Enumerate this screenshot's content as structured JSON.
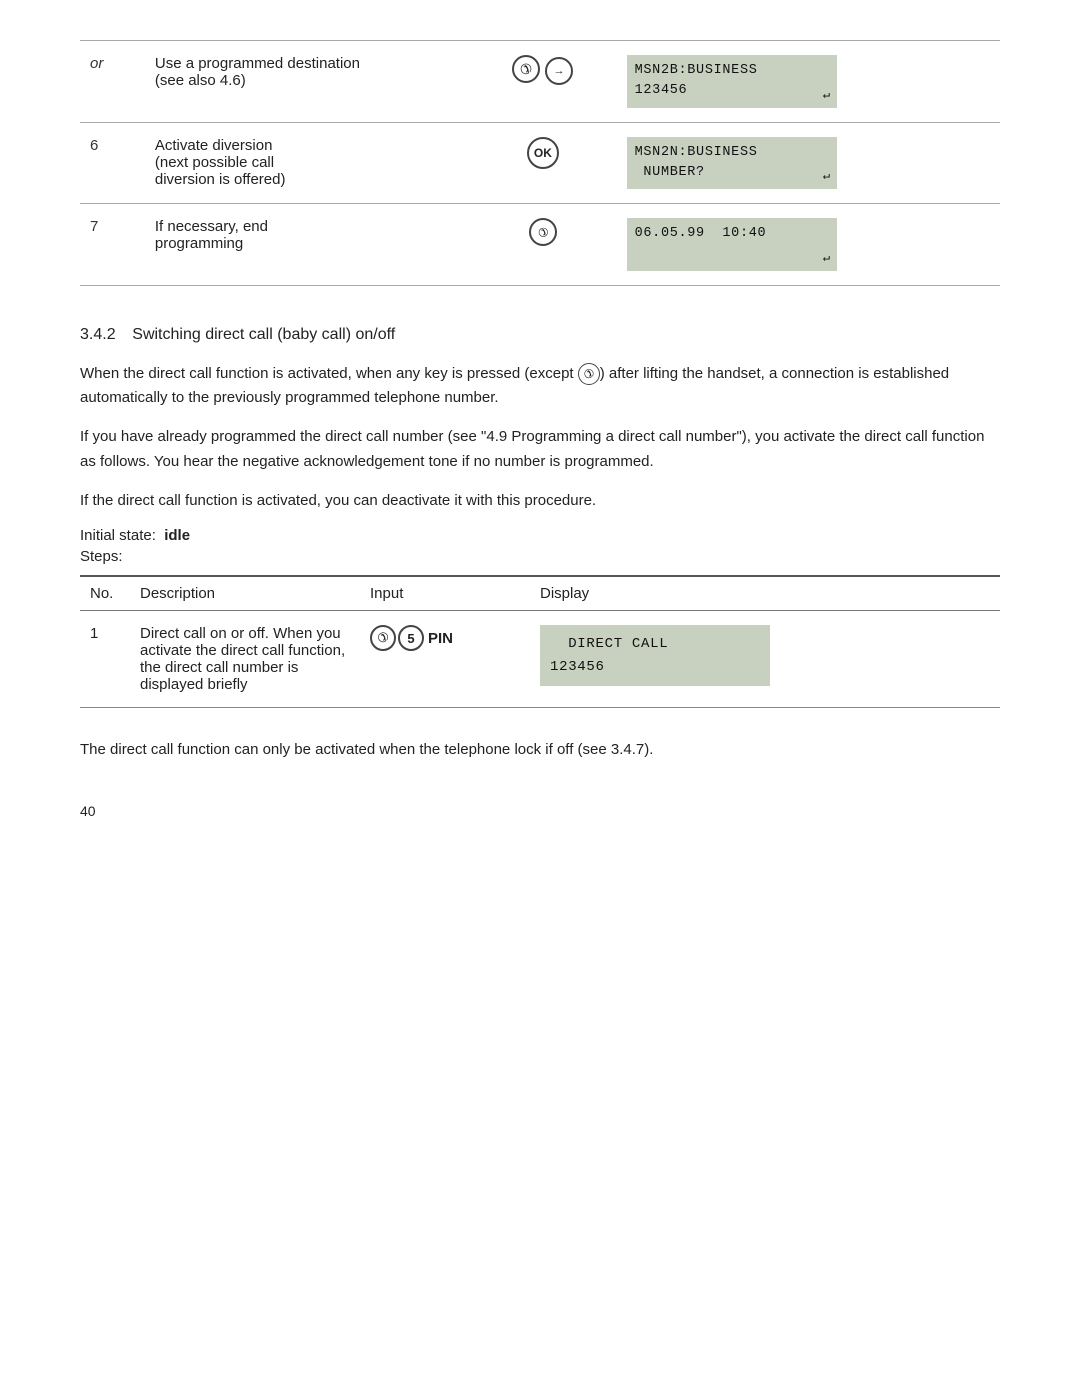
{
  "top_table": {
    "rows": [
      {
        "num": "or",
        "num_italic": true,
        "desc": "Use a programmed destination\n(see also 4.6)",
        "input_type": "two_circles",
        "display_lines": [
          "MSN2B:BUSINESS",
          "123456 "
        ],
        "show_back_arrow": true
      },
      {
        "num": "6",
        "desc": "Activate diversion\n(next possible call\ndiversion is offered)",
        "input_type": "ok",
        "display_lines": [
          "MSN2N:BUSINESS",
          " NUMBER?"
        ],
        "show_back_arrow": true
      },
      {
        "num": "7",
        "desc": "If necessary, end\nprogramming",
        "input_type": "end_call",
        "display_lines": [
          "06.05.99  10:40",
          ""
        ],
        "show_back_arrow": true
      }
    ]
  },
  "section": {
    "number": "3.4.2",
    "title": "Switching direct call (baby call) on/off"
  },
  "body_paragraphs": [
    "When the direct call function is activated, when any key is pressed (except ①) after lifting the handset, a connection is established automatically to the previously programmed telephone number.",
    "If you have already programmed the direct call number (see \"4.9 Programming a direct call number\"), you activate the direct call function as follows. You hear the negative acknowledgement tone if no number is programmed.",
    "If the direct call function is activated, you can deactivate it with this procedure."
  ],
  "initial_state_label": "Initial state:",
  "initial_state_value": "idle",
  "steps_label": "Steps:",
  "steps_table": {
    "headers": [
      "No.",
      "Description",
      "Input",
      "Display"
    ],
    "rows": [
      {
        "no": "1",
        "desc": "Direct call on or off. When you activate the direct call function, the direct call number is displayed briefly",
        "input_type": "phone_5_pin",
        "display_lines": [
          "  DIRECT CALL",
          "123456"
        ]
      }
    ]
  },
  "footer_text": "The direct call function can only be activated when the telephone lock if off (see 3.4.7).",
  "page_number": "40",
  "icons": {
    "phone_symbol": "☎",
    "back_arrow": "↩",
    "ok_label": "OK"
  }
}
